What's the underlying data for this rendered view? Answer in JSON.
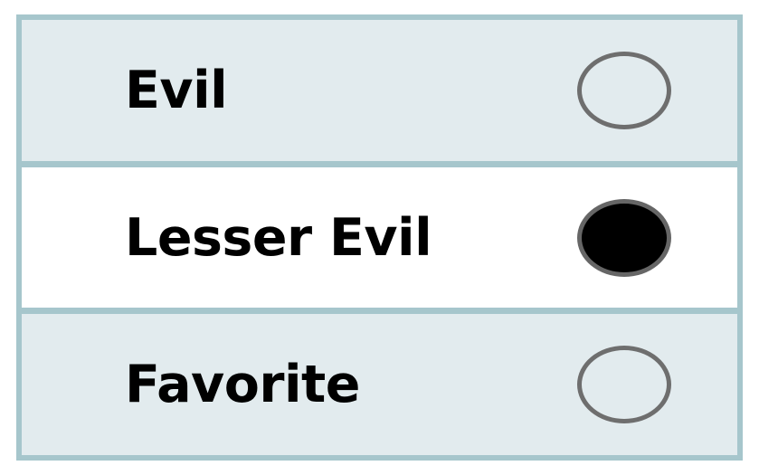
{
  "ballot": {
    "options": [
      {
        "label": "Evil",
        "selected": false
      },
      {
        "label": "Lesser Evil",
        "selected": true
      },
      {
        "label": "Favorite",
        "selected": false
      }
    ]
  },
  "colors": {
    "border": "#a6c6cc",
    "row_shaded": "#e2ebee",
    "row_plain": "#ffffff",
    "radio_ring": "#6e6e6e",
    "radio_fill": "#000000"
  }
}
